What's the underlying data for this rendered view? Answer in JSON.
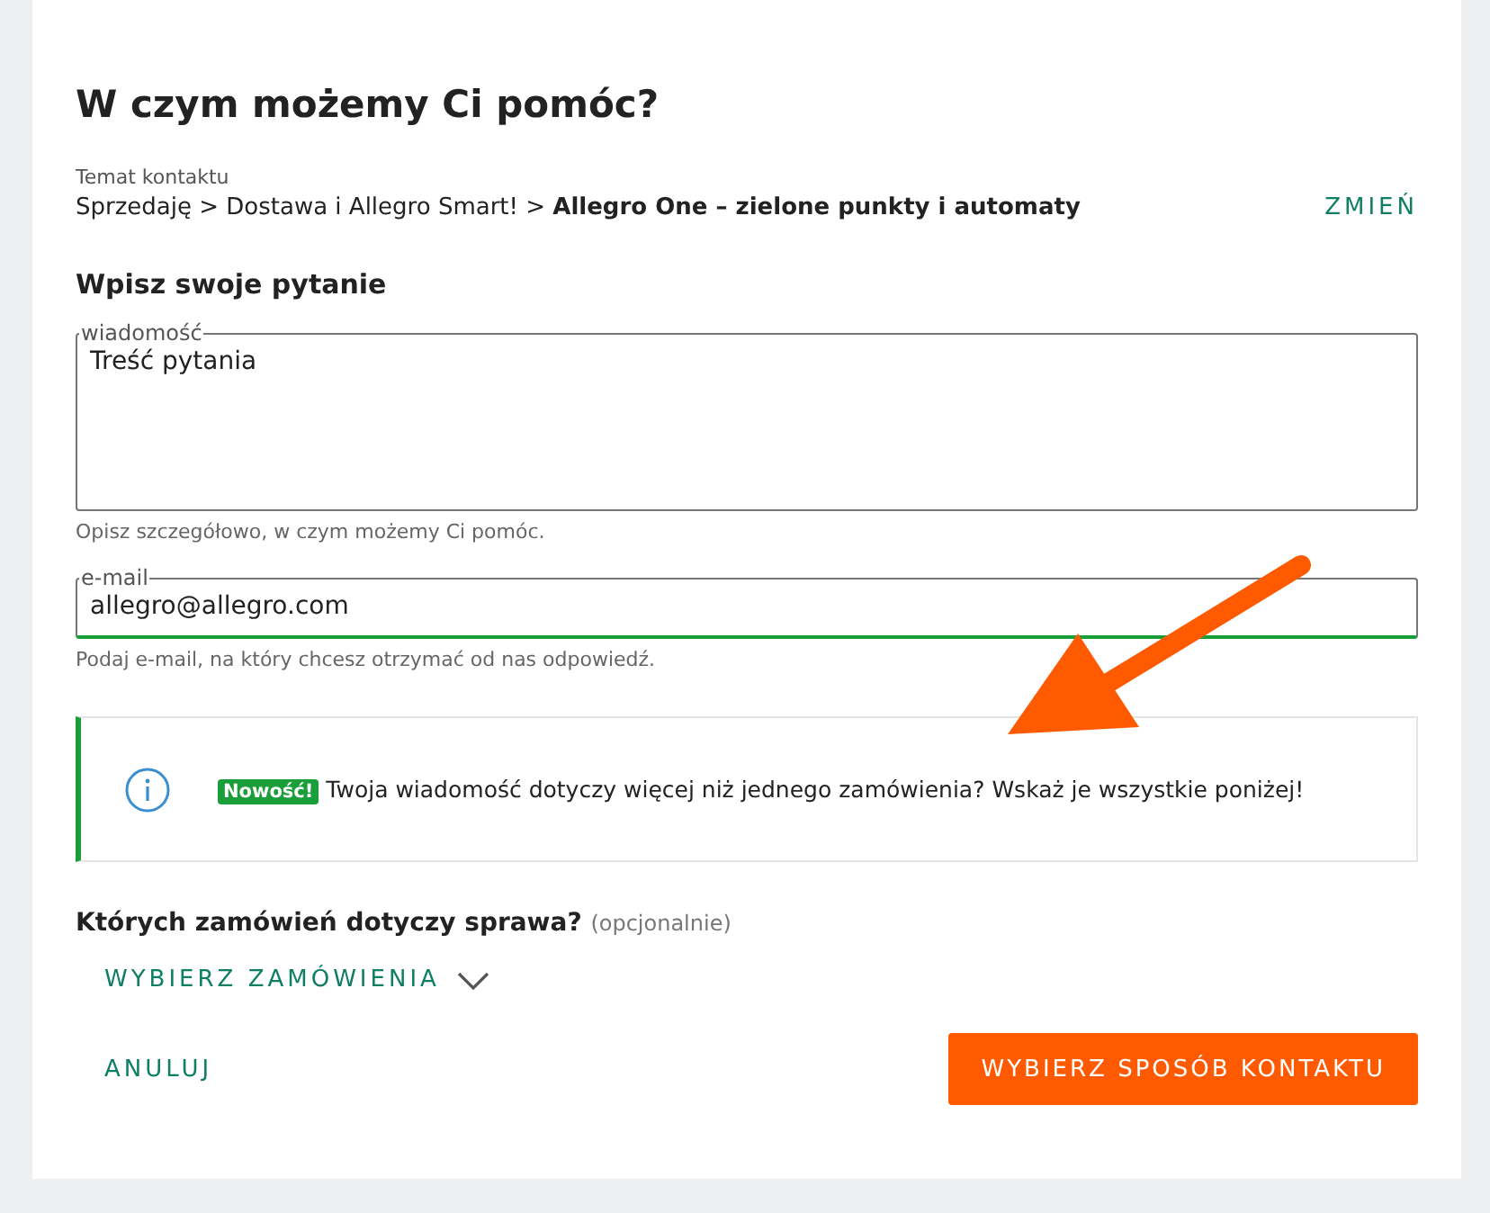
{
  "title": "W czym możemy Ci pomóc?",
  "topic": {
    "label": "Temat kontaktu",
    "path": "Sprzedaję > Dostawa i Allegro Smart! > **Allegro One – zielone punkty i automaty**",
    "change": "ZMIEŃ"
  },
  "question_heading": "Wpisz swoje pytanie",
  "fields": [
    {
      "kind": "textarea",
      "label": "wiadomość",
      "value": "Treść pytania",
      "hint": "Opisz szczegółowo, w czym możemy Ci pomóc.",
      "valid": false
    },
    {
      "kind": "input",
      "label": "e-mail",
      "value": "allegro@allegro.com",
      "hint": "Podaj e-mail, na który chcesz otrzymać od nas odpowiedź.",
      "valid": true
    }
  ],
  "notice": {
    "badge": "Nowość!",
    "text": "Twoja wiadomość dotyczy więcej niż jednego zamówienia? Wskaż je wszystkie poniżej!"
  },
  "orders": {
    "heading": "Których zamówień dotyczy sprawa?",
    "optional": "(opcjonalnie)",
    "dropdown": "WYBIERZ ZAMÓWIENIA",
    "expanded": false
  },
  "actions": {
    "cancel": "ANULUJ",
    "submit": "WYBIERZ SPOSÓB KONTAKTU"
  }
}
